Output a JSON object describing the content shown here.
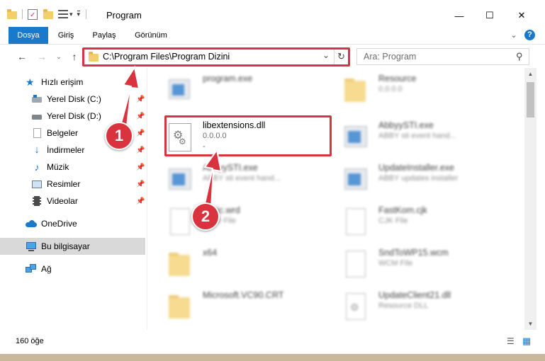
{
  "window": {
    "title": "Program",
    "controls": {
      "minimize": "—",
      "maximize": "☐",
      "close": "✕"
    }
  },
  "ribbon": {
    "tabs": [
      "Dosya",
      "Giriş",
      "Paylaş",
      "Görünüm"
    ],
    "help": "?",
    "collapse": "⌄"
  },
  "nav": {
    "back": "←",
    "forward": "→",
    "recent": "⌄",
    "up": "↑",
    "address": "C:\\Program Files\\Program Dizini",
    "dropdown": "⌄",
    "refresh": "↻",
    "search_placeholder": "Ara: Program",
    "search_icon": "⚲"
  },
  "sidebar": {
    "items": [
      {
        "label": "Hızlı erişim",
        "icon": "star-icon",
        "pinned": false
      },
      {
        "label": "Yerel Disk (C:)",
        "icon": "drive-icon",
        "pinned": true
      },
      {
        "label": "Yerel Disk (D:)",
        "icon": "drive-icon",
        "pinned": true
      },
      {
        "label": "Belgeler",
        "icon": "documents-icon",
        "pinned": true
      },
      {
        "label": "İndirmeler",
        "icon": "download-icon",
        "pinned": true
      },
      {
        "label": "Müzik",
        "icon": "music-icon",
        "pinned": true
      },
      {
        "label": "Resimler",
        "icon": "pictures-icon",
        "pinned": true
      },
      {
        "label": "Videolar",
        "icon": "videos-icon",
        "pinned": true
      },
      {
        "label": "OneDrive",
        "icon": "cloud-icon",
        "pinned": false
      },
      {
        "label": "Bu bilgisayar",
        "icon": "computer-icon",
        "pinned": false
      },
      {
        "label": "Ağ",
        "icon": "network-icon",
        "pinned": false
      }
    ],
    "pin_glyph": "📌"
  },
  "files": [
    {
      "name": "program.exe",
      "sub": "",
      "type": "exe",
      "blurred": true
    },
    {
      "name": "Resource",
      "sub": "0.0.0.0",
      "type": "folder",
      "blurred": true
    },
    {
      "name": "libextensions.dll",
      "sub": "0.0.0.0",
      "sub2": "-",
      "type": "dll",
      "blurred": false
    },
    {
      "name": "AbbyySTI.exe",
      "sub": "ABBY sti event hand...",
      "type": "exe",
      "blurred": true
    },
    {
      "name": "AbbyySTI.exe",
      "sub": "ABBY sti event hand...",
      "type": "exe",
      "blurred": true
    },
    {
      "name": "UpdateInstaller.exe",
      "sub": "ABBY updates installer",
      "type": "exe",
      "blurred": true
    },
    {
      "name": "basic.wrd",
      "sub": "WRD File",
      "type": "doc",
      "blurred": true
    },
    {
      "name": "FastKom.cjk",
      "sub": "CJK File",
      "type": "doc",
      "blurred": true
    },
    {
      "name": "x64",
      "sub": "",
      "type": "folder",
      "blurred": true
    },
    {
      "name": "SndToWP15.wcm",
      "sub": "WCM File",
      "type": "doc",
      "blurred": true
    },
    {
      "name": "Microsoft.VC90.CRT",
      "sub": "",
      "type": "folder",
      "blurred": true
    },
    {
      "name": "UpdateClient21.dll",
      "sub": "Resource DLL",
      "type": "dll",
      "blurred": true
    }
  ],
  "annotations": {
    "step1": "1",
    "step2": "2"
  },
  "status": {
    "count": "160 öğe",
    "details_view": "☰",
    "tiles_view": "▦"
  },
  "scrollbar": {
    "up": "▲",
    "down": "▼"
  },
  "colors": {
    "accent": "#1979ca",
    "highlight": "#d9333f",
    "selected": "#d9d9d9"
  }
}
